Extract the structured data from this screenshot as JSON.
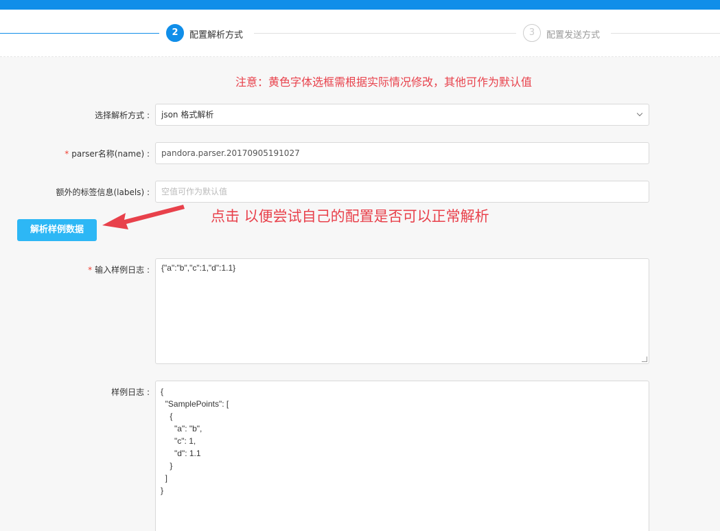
{
  "steps": [
    {
      "number": "2",
      "label": "配置解析方式",
      "state": "active"
    },
    {
      "number": "3",
      "label": "配置发送方式",
      "state": "todo"
    }
  ],
  "notice": "注意：黄色字体选框需根据实际情况修改，其他可作为默认值",
  "form": {
    "parser_type": {
      "label": "选择解析方式 :",
      "value": "json 格式解析"
    },
    "parser_name": {
      "label": "parser名称(name) :",
      "required": "*",
      "value": "pandora.parser.20170905191027"
    },
    "labels": {
      "label": "额外的标签信息(labels) :",
      "placeholder": "空值可作为默认值"
    },
    "parse_button": "解析样例数据",
    "sample_input": {
      "label": "输入样例日志 :",
      "required": "*",
      "value": "{\"a\":\"b\",\"c\":1,\"d\":1.1}"
    },
    "sample_output": {
      "label": "样例日志 :",
      "lines": [
        "{",
        "  \"SamplePoints\": [",
        "    {",
        "      \"a\": \"b\",",
        "      \"c\": 1,",
        "      \"d\": 1.1",
        "    }",
        "  ]",
        "}"
      ]
    }
  },
  "annotation": "点击 以便尝试自己的配置是否可以正常解析",
  "colors": {
    "primary": "#108ee9",
    "button": "#2db7f5",
    "annotation_red": "#e8414b"
  }
}
